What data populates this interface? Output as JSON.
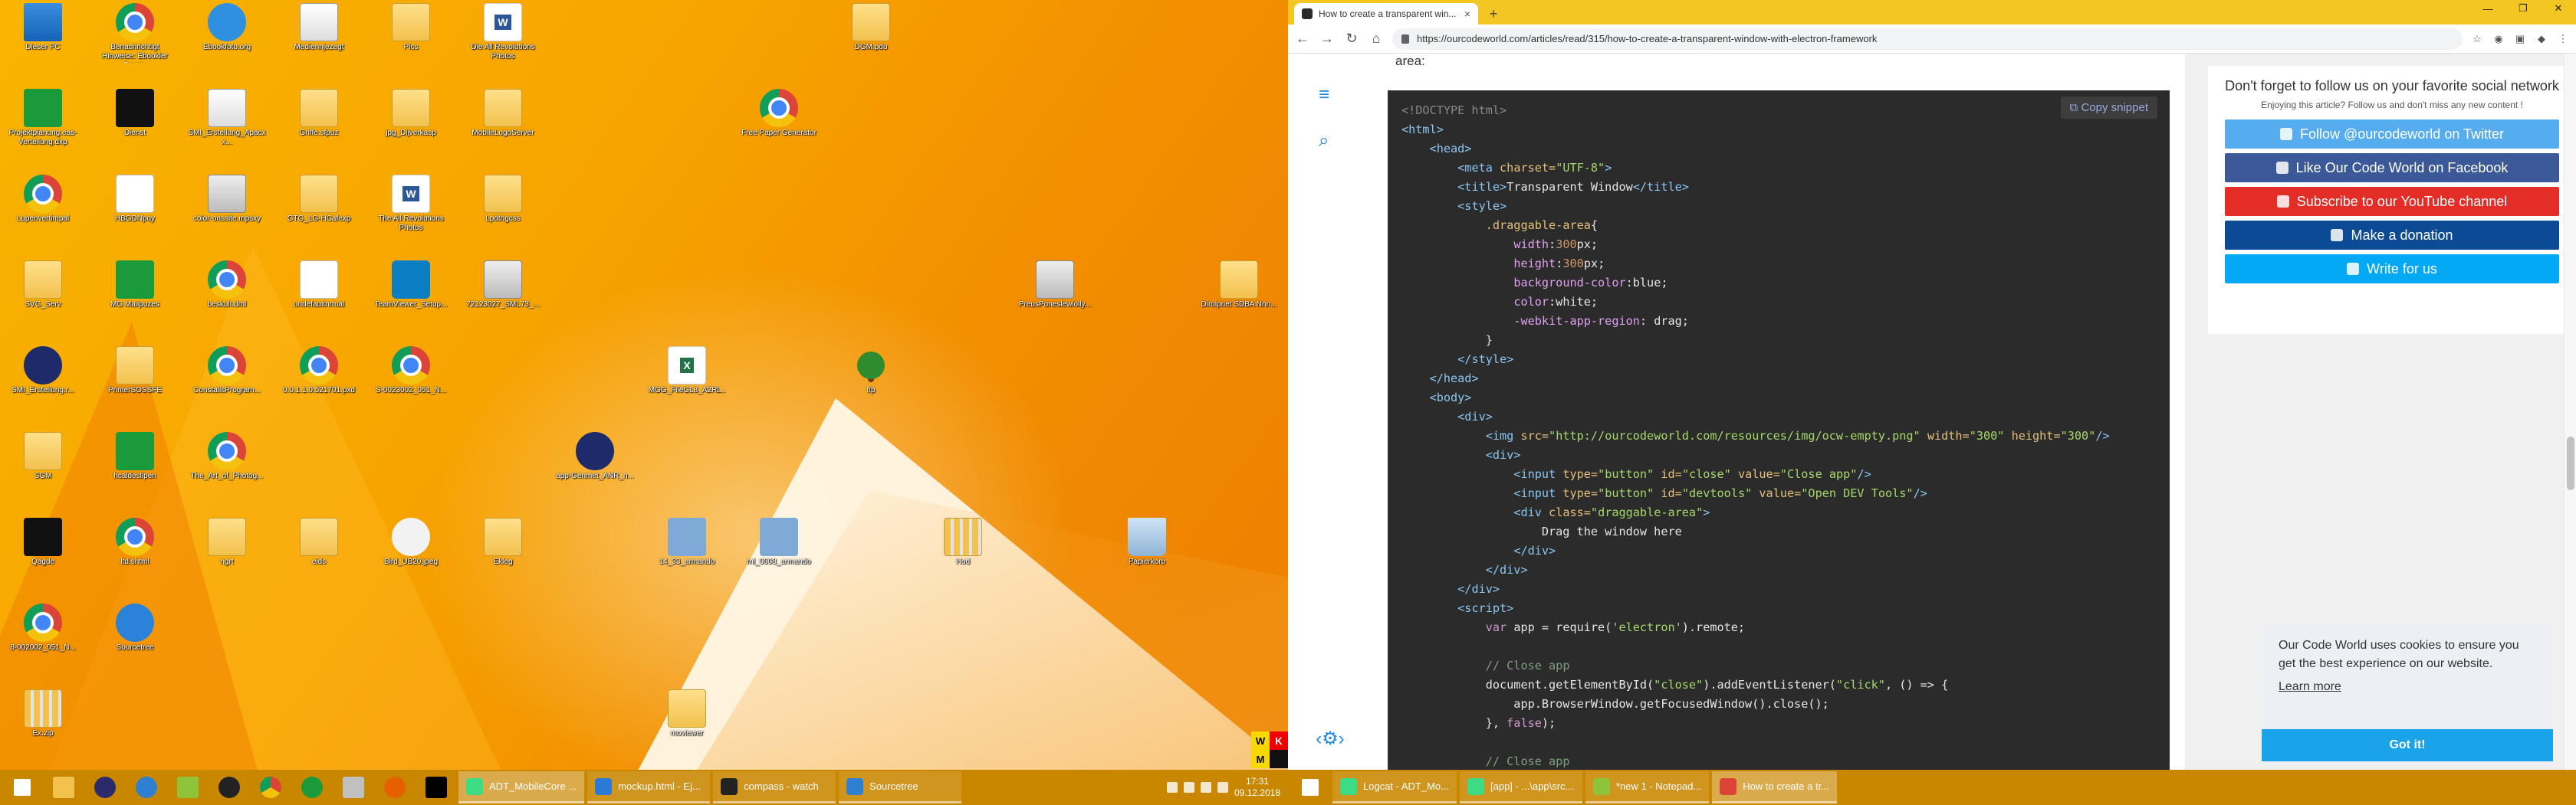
{
  "desktop": {
    "icons": [
      {
        "label": "Dieser PC",
        "kind": "pc"
      },
      {
        "label": "Benachrichtigt Hinweise: Ebookler Rocsty",
        "kind": "chrome"
      },
      {
        "label": "Ebookfoto.org",
        "kind": "ie"
      },
      {
        "label": "Mediennjezegt",
        "kind": "rect"
      },
      {
        "label": "Pics",
        "kind": "folder"
      },
      {
        "label": "Die All Revolutions Photos",
        "kind": "word"
      },
      {
        "label": "DGM.pdu",
        "kind": "folder"
      },
      {
        "label": "Projektplanung.eas-Verteilung.dxp",
        "kind": "green"
      },
      {
        "label": "Dienst",
        "kind": "dark"
      },
      {
        "label": "SMI_Erstellung_Apacxx...",
        "kind": "rect"
      },
      {
        "label": "Griffe.sfpuz",
        "kind": "folder"
      },
      {
        "label": "jpg_Dijverkasp",
        "kind": "folder"
      },
      {
        "label": "MobileLogoServer",
        "kind": "folder"
      },
      {
        "label": "Free Paper Generator",
        "kind": "chrome"
      },
      {
        "label": "Lupenvertimpal",
        "kind": "chrome"
      },
      {
        "label": "HBGDNpoy",
        "kind": "doc"
      },
      {
        "label": "color-onssite.mpsxy",
        "kind": "image"
      },
      {
        "label": "GTG_LG-HCafexp",
        "kind": "folder"
      },
      {
        "label": "The All Revolutions Photos",
        "kind": "word"
      },
      {
        "label": "Lpdtngcss",
        "kind": "folder"
      },
      {
        "label": "PreusPoneslewlolly...",
        "kind": "image"
      },
      {
        "label": "Dirolpnet SDBA Nnn...",
        "kind": "folder"
      },
      {
        "label": "SVG_Serv",
        "kind": "folder"
      },
      {
        "label": "MG Mailpuzes",
        "kind": "green"
      },
      {
        "label": "beskult.dml",
        "kind": "chrome"
      },
      {
        "label": "undefaultnrmal",
        "kind": "doc"
      },
      {
        "label": "TeamViewer_Setup...",
        "kind": "teal"
      },
      {
        "label": "72123027_SML73_...",
        "kind": "image"
      },
      {
        "label": "MGG_FileGL8_A2RL..",
        "kind": "excel"
      },
      {
        "label": "ftp",
        "kind": "tree"
      },
      {
        "label": "SMI_Erstellung.r...",
        "kind": "navy"
      },
      {
        "label": "PrinterSOSSFE",
        "kind": "folder"
      },
      {
        "label": "ConstallsProgram...",
        "kind": "chrome"
      },
      {
        "label": "0.0.1.1.0.521701.pxd",
        "kind": "chrome"
      },
      {
        "label": "S-0023002_051_N...",
        "kind": "chrome"
      },
      {
        "label": "SGM",
        "kind": "folder"
      },
      {
        "label": "hcaldesllpen",
        "kind": "green"
      },
      {
        "label": "The_Art_of_Photog...",
        "kind": "chrome"
      },
      {
        "label": "app-Genmet_ANR_n...",
        "kind": "navy"
      },
      {
        "label": "Qagde",
        "kind": "dark"
      },
      {
        "label": "ltd.shtml",
        "kind": "chrome"
      },
      {
        "label": "ngrt",
        "kind": "folder"
      },
      {
        "label": "eids",
        "kind": "folder"
      },
      {
        "label": "Bird_UB20.jpeg",
        "kind": "bird"
      },
      {
        "label": "Ekleg",
        "kind": "folder"
      },
      {
        "label": "14_33_armando",
        "kind": "network"
      },
      {
        "label": "ml_0008_armando",
        "kind": "network"
      },
      {
        "label": "Hod",
        "kind": "zip"
      },
      {
        "label": "Papierkorb",
        "kind": "bin"
      },
      {
        "label": "8-002002_051_N...",
        "kind": "chrome"
      },
      {
        "label": "Sourcetree",
        "kind": "app"
      },
      {
        "label": "Ex.zip",
        "kind": "zip"
      },
      {
        "label": "moviewer",
        "kind": "folder"
      }
    ],
    "badge": {
      "w": "W",
      "k": "K",
      "m": "M"
    }
  },
  "browser": {
    "tab_title": "How to create a transparent win...",
    "tab_close": "×",
    "new_tab": "+",
    "window_controls": [
      "—",
      "❐",
      "✕"
    ],
    "url": "https://ourcodeworld.com/articles/read/315/how-to-create-a-transparent-window-with-electron-framework",
    "article_text_fragment": "area:",
    "copy_label": "Copy snippet",
    "code_lines_note": "code shown in pre block",
    "follow_heading": "Don't forget to follow us on your favorite social network",
    "follow_sub": "Enjoying this article? Follow us and don't miss any new content !",
    "social_buttons": [
      {
        "label": "Follow @ourcodeworld on Twitter",
        "color": "#55acee"
      },
      {
        "label": "Like Our Code World on Facebook",
        "color": "#3b5998"
      },
      {
        "label": "Subscribe to our YouTube channel",
        "color": "#e52d27"
      },
      {
        "label": "Make a donation",
        "color": "#0c4a96"
      },
      {
        "label": "Write for us",
        "color": "#03a9f4"
      }
    ],
    "cookie_text": "Our Code World uses cookies to ensure you get the best experience on our website.",
    "cookie_link": "Learn more",
    "cookie_button": "Got it!"
  },
  "taskbar_left": {
    "windows": [
      {
        "label": "ADT_MobileCore ...",
        "color": "#3ddc84"
      },
      {
        "label": "mockup.html - Ej...",
        "color": "#2b7bd6"
      },
      {
        "label": "compass - watch",
        "color": "#222"
      },
      {
        "label": "Sourcetree",
        "color": "#2f80d0"
      }
    ],
    "clock_time": "17:31",
    "clock_date": "09.12.2018"
  },
  "taskbar_right": {
    "windows": [
      {
        "label": "Logcat - ADT_Mo...",
        "color": "#3ddc84"
      },
      {
        "label": "[app] - ...\\app\\src...",
        "color": "#3ddc84"
      },
      {
        "label": "*new 1 - Notepad...",
        "color": "#8fc43a"
      },
      {
        "label": "How to create a tr...",
        "color": "#db4437"
      }
    ]
  }
}
